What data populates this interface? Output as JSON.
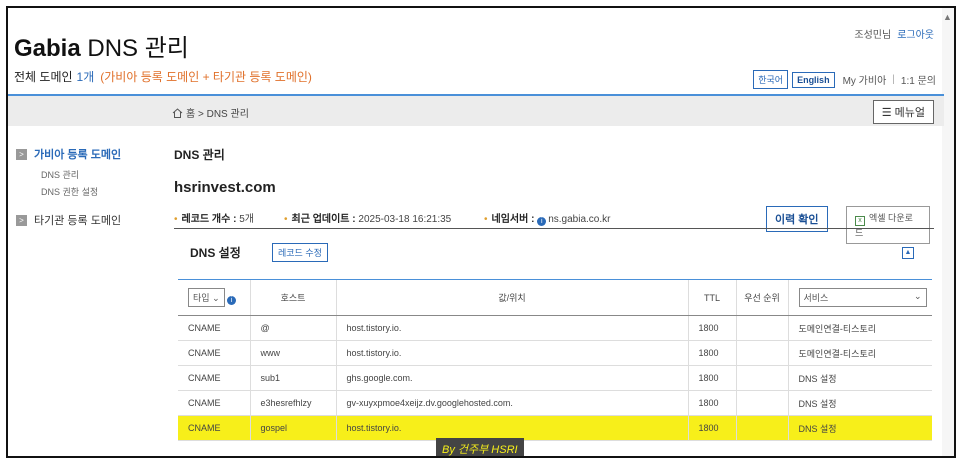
{
  "header": {
    "brand_bold": "Gabia",
    "brand_rest": " DNS 관리",
    "user_name": "조성민님",
    "logout_label": "로그아웃",
    "domain_label": "전체 도메인",
    "domain_count": "1개",
    "domain_note": "(가비아 등록 도메인 + 타기관 등록 도메인)",
    "lang_ko": "한국어",
    "lang_en": "English",
    "my_gabia": "My 가비아",
    "separator": "|",
    "support": "1:1 문의"
  },
  "breadcrumb": {
    "home": "홈",
    "arrow": ">",
    "current": "DNS 관리"
  },
  "menu_button": "메뉴얼",
  "sidebar": {
    "group1": "가비아 등록 도메인",
    "sub1": "DNS 관리",
    "sub2": "DNS 권한 설정",
    "group2": "타기관 등록 도메인",
    "arrow_glyph": ">"
  },
  "main": {
    "title": "DNS 관리",
    "domain": "hsrinvest.com",
    "record_count_label": "레코드 개수 :",
    "record_count_value": "5개",
    "updated_label": "최근 업데이트 :",
    "updated_value": "2025-03-18 16:21:35",
    "nameserver_label": "네임서버 :",
    "nameserver_value": "ns.gabia.co.kr",
    "history_button": "이력 확인",
    "excel_button": "엑셀 다운로드"
  },
  "dns_settings": {
    "title": "DNS 설정",
    "edit_button": "레코드 수정",
    "columns": {
      "type": "타입",
      "host": "호스트",
      "value": "값/위치",
      "ttl": "TTL",
      "priority": "우선 순위",
      "service": "서비스"
    },
    "rows": [
      {
        "type": "CNAME",
        "host": "@",
        "value": "host.tistory.io.",
        "ttl": "1800",
        "priority": "",
        "service": "도메인연결-티스토리"
      },
      {
        "type": "CNAME",
        "host": "www",
        "value": "host.tistory.io.",
        "ttl": "1800",
        "priority": "",
        "service": "도메인연결-티스토리"
      },
      {
        "type": "CNAME",
        "host": "sub1",
        "value": "ghs.google.com.",
        "ttl": "1800",
        "priority": "",
        "service": "DNS 설정"
      },
      {
        "type": "CNAME",
        "host": "e3hesrefhlzy",
        "value": "gv-xuyxpmoe4xeijz.dv.googlehosted.com.",
        "ttl": "1800",
        "priority": "",
        "service": "DNS 설정"
      },
      {
        "type": "CNAME",
        "host": "gospel",
        "value": "host.tistory.io.",
        "ttl": "1800",
        "priority": "",
        "service": "DNS 설정"
      }
    ]
  },
  "watermark": "By 건주부 HSRI",
  "colors": {
    "accent": "#2a6ab8",
    "highlight": "#f7ef1a",
    "note": "#e0702a"
  }
}
